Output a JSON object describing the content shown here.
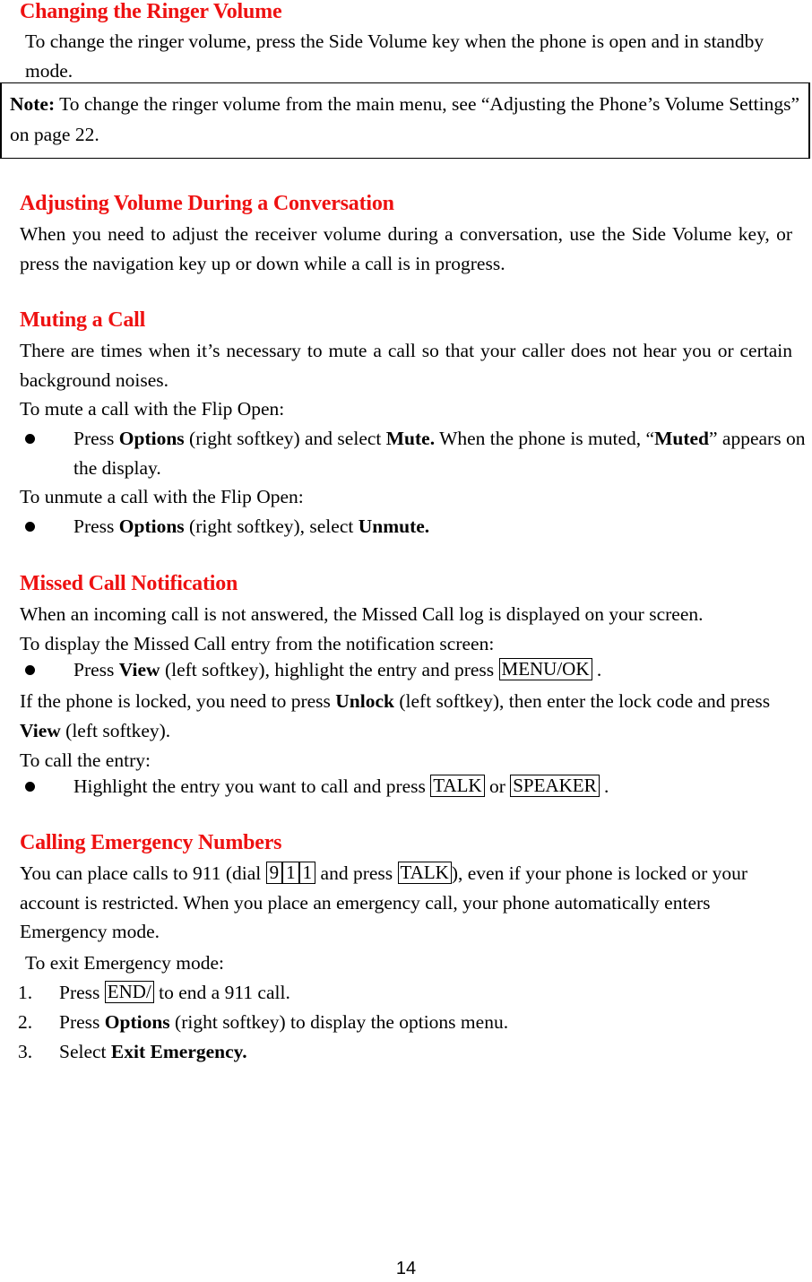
{
  "document": {
    "page_number": "14",
    "accent_color": "#ee1111",
    "text_color": "#000000"
  },
  "sections": [
    {
      "id": "changing-ringer-volume",
      "heading": "Changing the Ringer Volume",
      "paragraph": "To change the ringer volume, press the Side Volume key when the phone is open and in standby mode."
    },
    {
      "id": "adjusting-volume-conversation",
      "heading": "Adjusting Volume During a Conversation",
      "paragraph": "When you need to adjust the receiver volume during a conversation, use the Side Volume key, or press the navigation key up or down while a call is in progress."
    },
    {
      "id": "muting-a-call",
      "heading": "Muting a Call",
      "paragraph": "There are times when it’s necessary to mute a call so that your caller does not hear you or certain background noises.",
      "lead_mute": "To mute a call with the Flip Open:",
      "bullet_mute_a": "Press ",
      "bullet_mute_options": "Options",
      "bullet_mute_b": " (right softkey) and select ",
      "bullet_mute_mute": "Mute.",
      "bullet_mute_c": " When the phone is muted, “",
      "bullet_mute_muted": "Muted",
      "bullet_mute_d": "” appears on the display.",
      "lead_unmute": "To unmute a call with the Flip Open:",
      "bullet_unmute_a": "Press ",
      "bullet_unmute_options": "Options",
      "bullet_unmute_b": " (right softkey), select ",
      "bullet_unmute_unmute": "Unmute."
    },
    {
      "id": "missed-call-notification",
      "heading": "Missed Call Notification",
      "paragraph": "When an incoming call is not answered, the Missed Call log is displayed on your screen.",
      "lead_display": "To display the Missed Call entry from the notification screen:",
      "bullet_view_a": "Press ",
      "bullet_view_view": "View",
      "bullet_view_b": " (left softkey), highlight the entry and press ",
      "key_menu_ok": "MENU/OK",
      "bullet_view_c": " .",
      "locked_a": "If the phone is locked, you need to press ",
      "locked_unlock": "Unlock",
      "locked_b": " (left softkey), then enter the lock code and press ",
      "locked_view": "View",
      "locked_c": " (left softkey).",
      "lead_call": "To call the entry:",
      "bullet_call_a": "Highlight the entry you want to call and press ",
      "key_talk": "TALK",
      "bullet_call_b": " or ",
      "key_speaker": "SPEAKER",
      "bullet_call_c": " ."
    },
    {
      "id": "calling-emergency-numbers",
      "heading": "Calling Emergency Numbers",
      "para_a": "You can place calls to 911 (dial ",
      "key_9": "9",
      "key_1a": "1",
      "key_1b": "1",
      "para_b": " and press ",
      "key_talk": "TALK",
      "para_c": "), even if your phone is locked or your account is restricted. When you place an emergency call, your phone automatically enters Emergency mode.",
      "lead_exit": "To exit Emergency mode:",
      "steps": [
        {
          "number": "1.",
          "text_a": "Press ",
          "key": "END/",
          "text_b": " to end a 911 call.",
          "bold": ""
        },
        {
          "number": "2.",
          "text_a": "Press ",
          "bold": "Options",
          "text_b": " (right softkey) to display the options menu.",
          "key": ""
        },
        {
          "number": "3.",
          "text_a": "Select ",
          "bold": "Exit Emergency.",
          "text_b": "",
          "key": ""
        }
      ]
    }
  ],
  "note": {
    "label": "Note:",
    "text_a": " To change the ringer volume from the main menu, see “Adjusting the Phone’s Volume Settings” on page 22."
  }
}
